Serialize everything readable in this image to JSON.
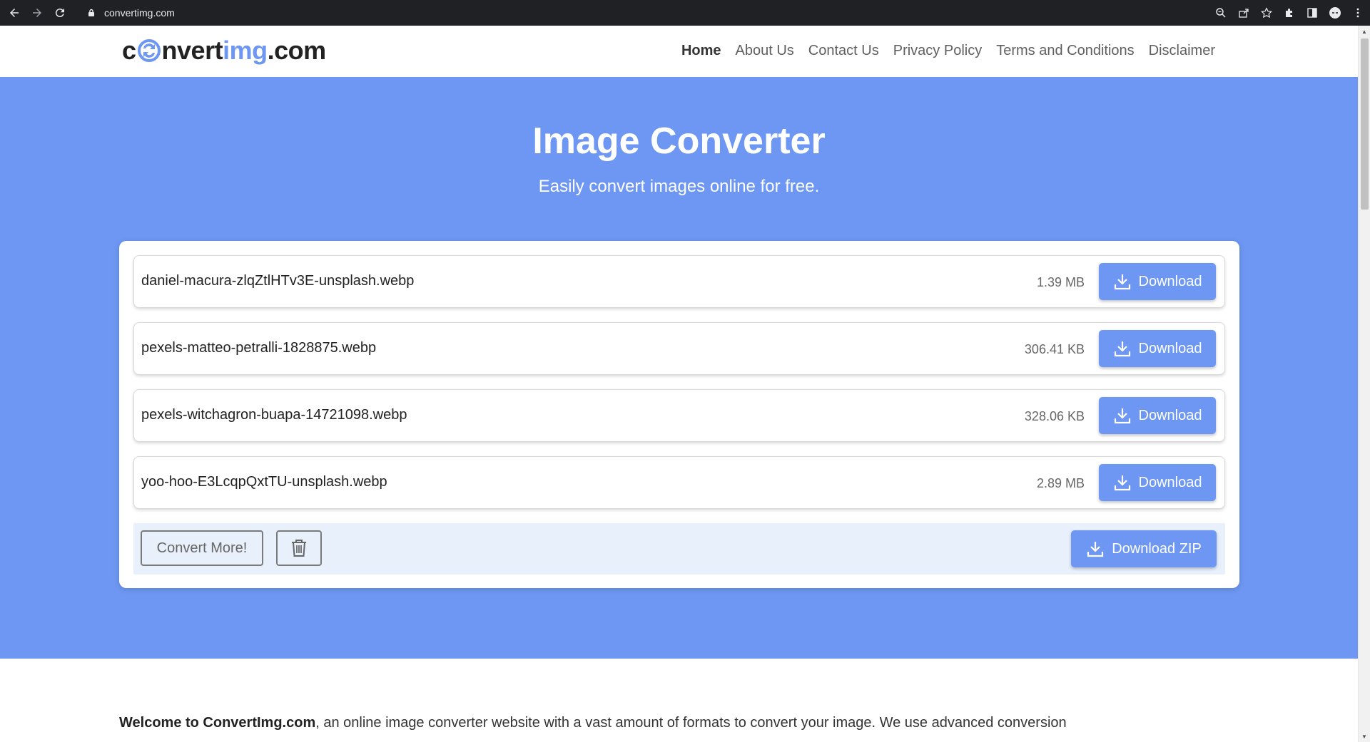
{
  "browser": {
    "url": "convertimg.com"
  },
  "logo": {
    "prefix": "c",
    "mid": "nvert",
    "blue": "img",
    "suffix": ".com"
  },
  "nav": {
    "items": [
      {
        "label": "Home",
        "active": true
      },
      {
        "label": "About Us",
        "active": false
      },
      {
        "label": "Contact Us",
        "active": false
      },
      {
        "label": "Privacy Policy",
        "active": false
      },
      {
        "label": "Terms and Conditions",
        "active": false
      },
      {
        "label": "Disclaimer",
        "active": false
      }
    ]
  },
  "hero": {
    "title": "Image Converter",
    "subtitle": "Easily convert images online for free."
  },
  "files": [
    {
      "name": "daniel-macura-zlqZtlHTv3E-unsplash.webp",
      "size": "1.39 MB",
      "download_label": "Download"
    },
    {
      "name": "pexels-matteo-petralli-1828875.webp",
      "size": "306.41 KB",
      "download_label": "Download"
    },
    {
      "name": "pexels-witchagron-buapa-14721098.webp",
      "size": "328.06 KB",
      "download_label": "Download"
    },
    {
      "name": "yoo-hoo-E3LcqpQxtTU-unsplash.webp",
      "size": "2.89 MB",
      "download_label": "Download"
    }
  ],
  "actions": {
    "convert_more": "Convert More!",
    "download_zip": "Download ZIP"
  },
  "welcome": {
    "bold": "Welcome to ConvertImg.com",
    "text": ", an online image converter website with a vast amount of formats to convert your image. We use advanced conversion"
  },
  "colors": {
    "accent": "#6d97f2",
    "action_bar_bg": "#e8f0fc"
  }
}
